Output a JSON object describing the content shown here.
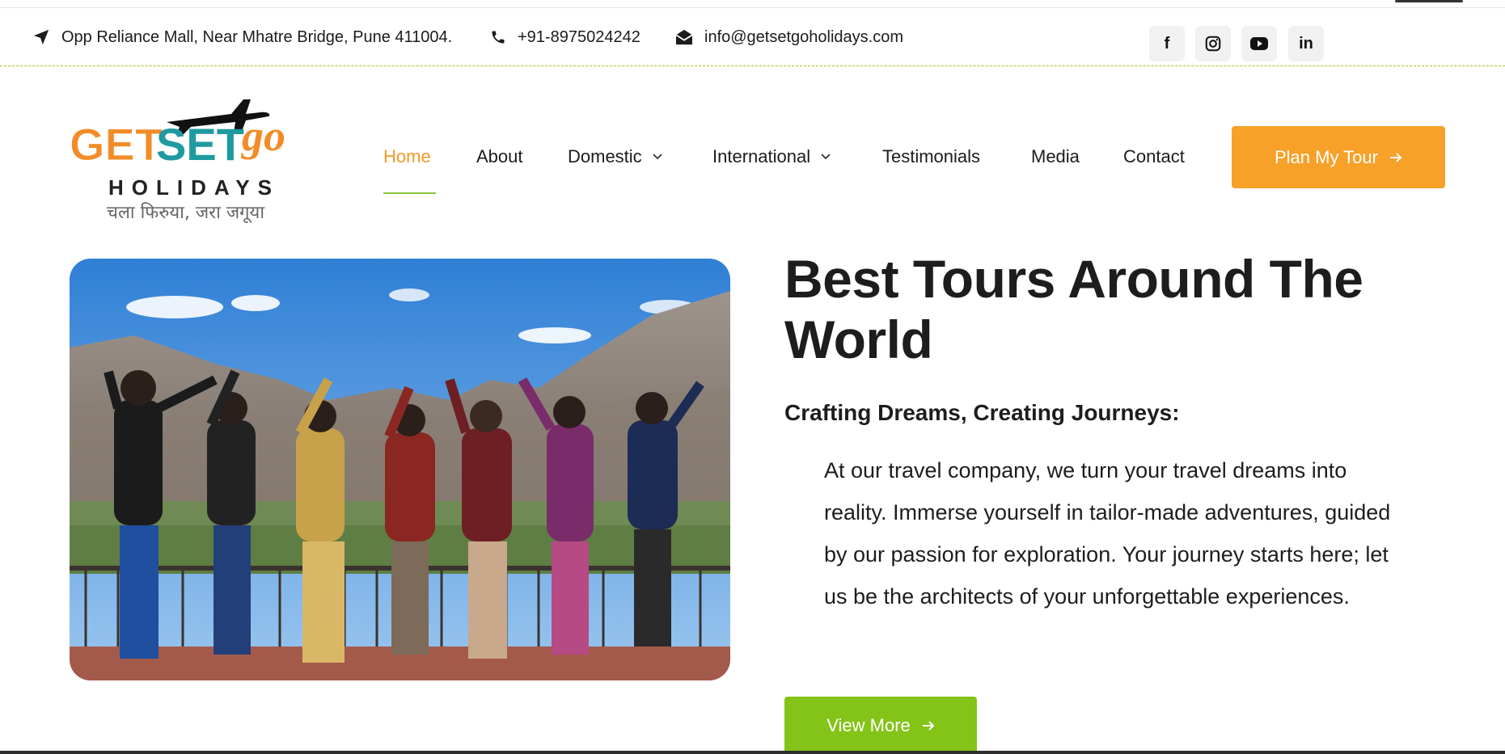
{
  "topbar": {
    "address": "Opp Reliance Mall, Near Mhatre Bridge, Pune 411004.",
    "phone": "+91-8975024242",
    "email": "info@getsetgoholidays.com",
    "social": [
      {
        "name": "facebook",
        "glyph": "f"
      },
      {
        "name": "instagram",
        "glyph": "◎"
      },
      {
        "name": "youtube",
        "glyph": "▶"
      },
      {
        "name": "linkedin",
        "glyph": "in"
      }
    ]
  },
  "logo": {
    "text_get": "GET",
    "text_set": "SET",
    "text_go": "go",
    "text_holidays": "HOLIDAYS",
    "tagline": "चला फिरुया, जरा जगूया",
    "colors": {
      "orange": "#f28c28",
      "teal": "#1f9aa0",
      "dark": "#333333"
    }
  },
  "nav": {
    "items": [
      {
        "label": "Home",
        "active": true
      },
      {
        "label": "About"
      },
      {
        "label": "Domestic",
        "has_dropdown": true
      },
      {
        "label": "International",
        "has_dropdown": true
      },
      {
        "label": "Testimonials"
      },
      {
        "label": "Media"
      },
      {
        "label": "Contact"
      }
    ],
    "cta_label": "Plan My Tour"
  },
  "hero": {
    "headline": "Best Tours Around The World",
    "subheading": "Crafting Dreams, Creating Journeys:",
    "paragraph": "At our travel company, we turn your travel dreams into reality. Immerse yourself in tailor-made adventures, guided by our passion for exploration. Your journey starts here; let us be the architects of your unforgettable experiences.",
    "button_label": "View More"
  },
  "colors": {
    "accent_orange": "#f7a128",
    "accent_green": "#84c317",
    "nav_active": "#f39a25",
    "text": "#1d1d1d"
  }
}
